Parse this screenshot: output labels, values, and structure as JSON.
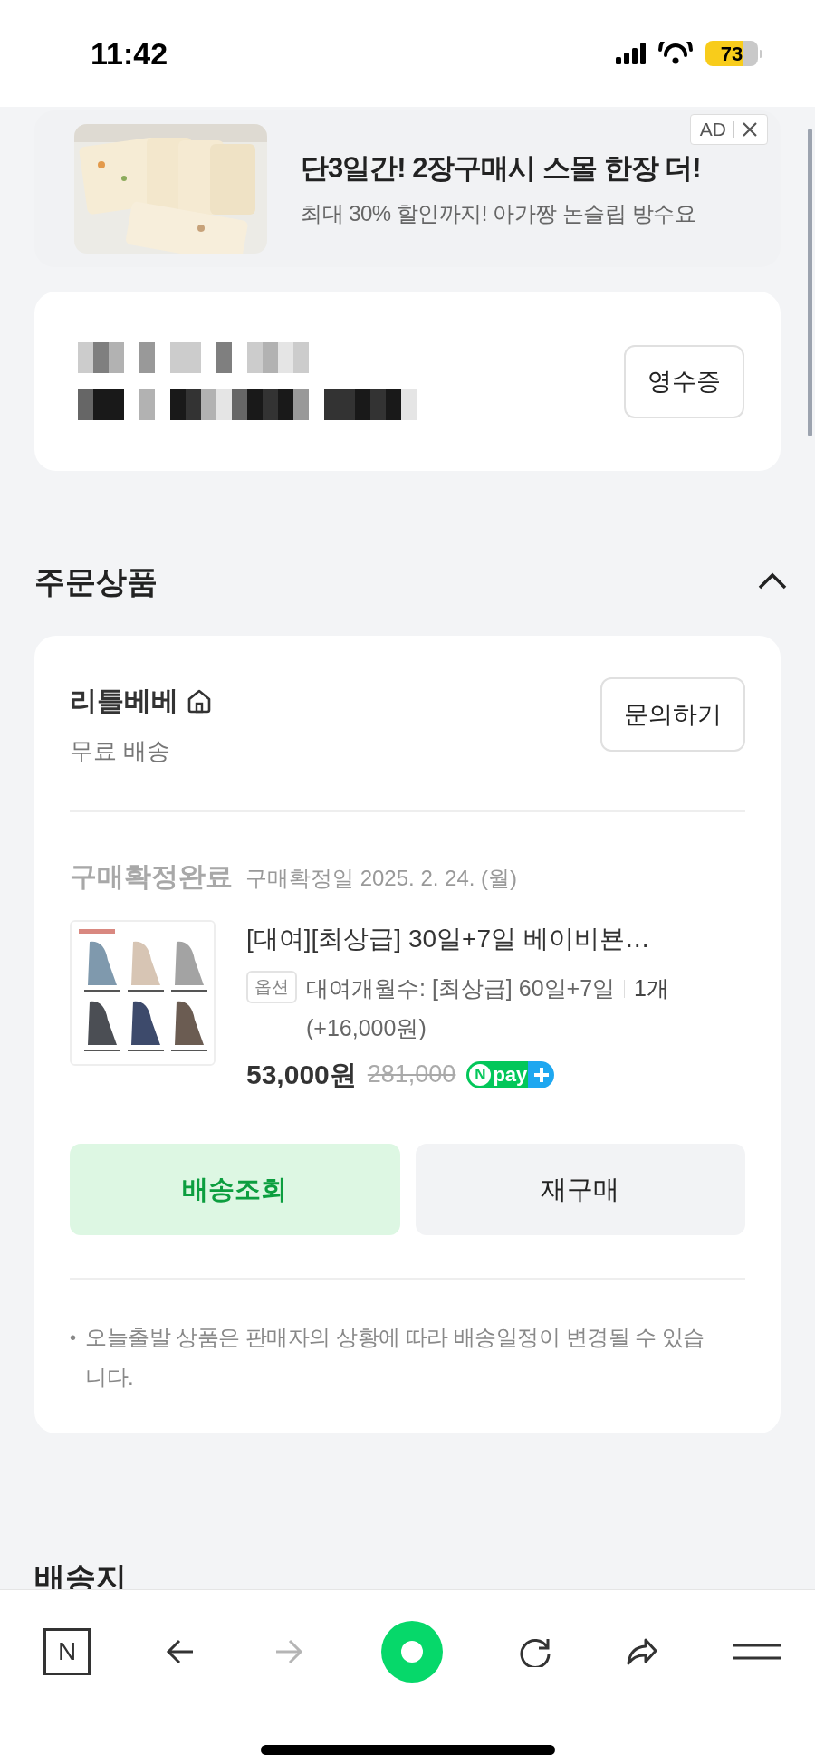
{
  "status_bar": {
    "time": "11:42",
    "battery": "73"
  },
  "ad": {
    "badge": "AD",
    "title": "단3일간! 2장구매시 스몰 한장 더!",
    "subtitle": "최대 30% 할인까지! 아가짱 논슬립 방수요"
  },
  "order_summary": {
    "receipt_button": "영수증"
  },
  "section": {
    "title": "주문상품",
    "expanded": true
  },
  "seller": {
    "name": "리틀베베",
    "shipping": "무료 배송",
    "inquiry_button": "문의하기"
  },
  "order": {
    "status": "구매확정완료",
    "confirm_date": "구매확정일 2025. 2. 24. (월)",
    "product": {
      "title": "[대여][최상급] 30일+7일 베이비뵨…",
      "option_label": "옵션",
      "option": "대여개월수: [최상급] 60일+7일",
      "quantity": "1개",
      "option_price": "(+16,000원)",
      "price": "53,000원",
      "original_price": "281,000",
      "pay_mark": "N",
      "pay_text": "pay"
    }
  },
  "buttons": [
    {
      "label": "배송조회",
      "kind": "primary"
    },
    {
      "label": "재구매",
      "kind": "secondary"
    }
  ],
  "notes": [
    {
      "bullet": "•",
      "text": "오늘출발 상품은 판매자의 상황에 따라 배송일정이 변경될 수 있습니다."
    }
  ],
  "next_section": {
    "title": "배송지"
  },
  "toolbar": [
    {
      "kind": "logo",
      "label": "N",
      "disabled": false
    },
    {
      "kind": "back",
      "disabled": false
    },
    {
      "kind": "forward",
      "disabled": true
    },
    {
      "kind": "home",
      "disabled": false
    },
    {
      "kind": "reload",
      "disabled": false
    },
    {
      "kind": "share",
      "disabled": false
    },
    {
      "kind": "menu",
      "disabled": false
    }
  ]
}
